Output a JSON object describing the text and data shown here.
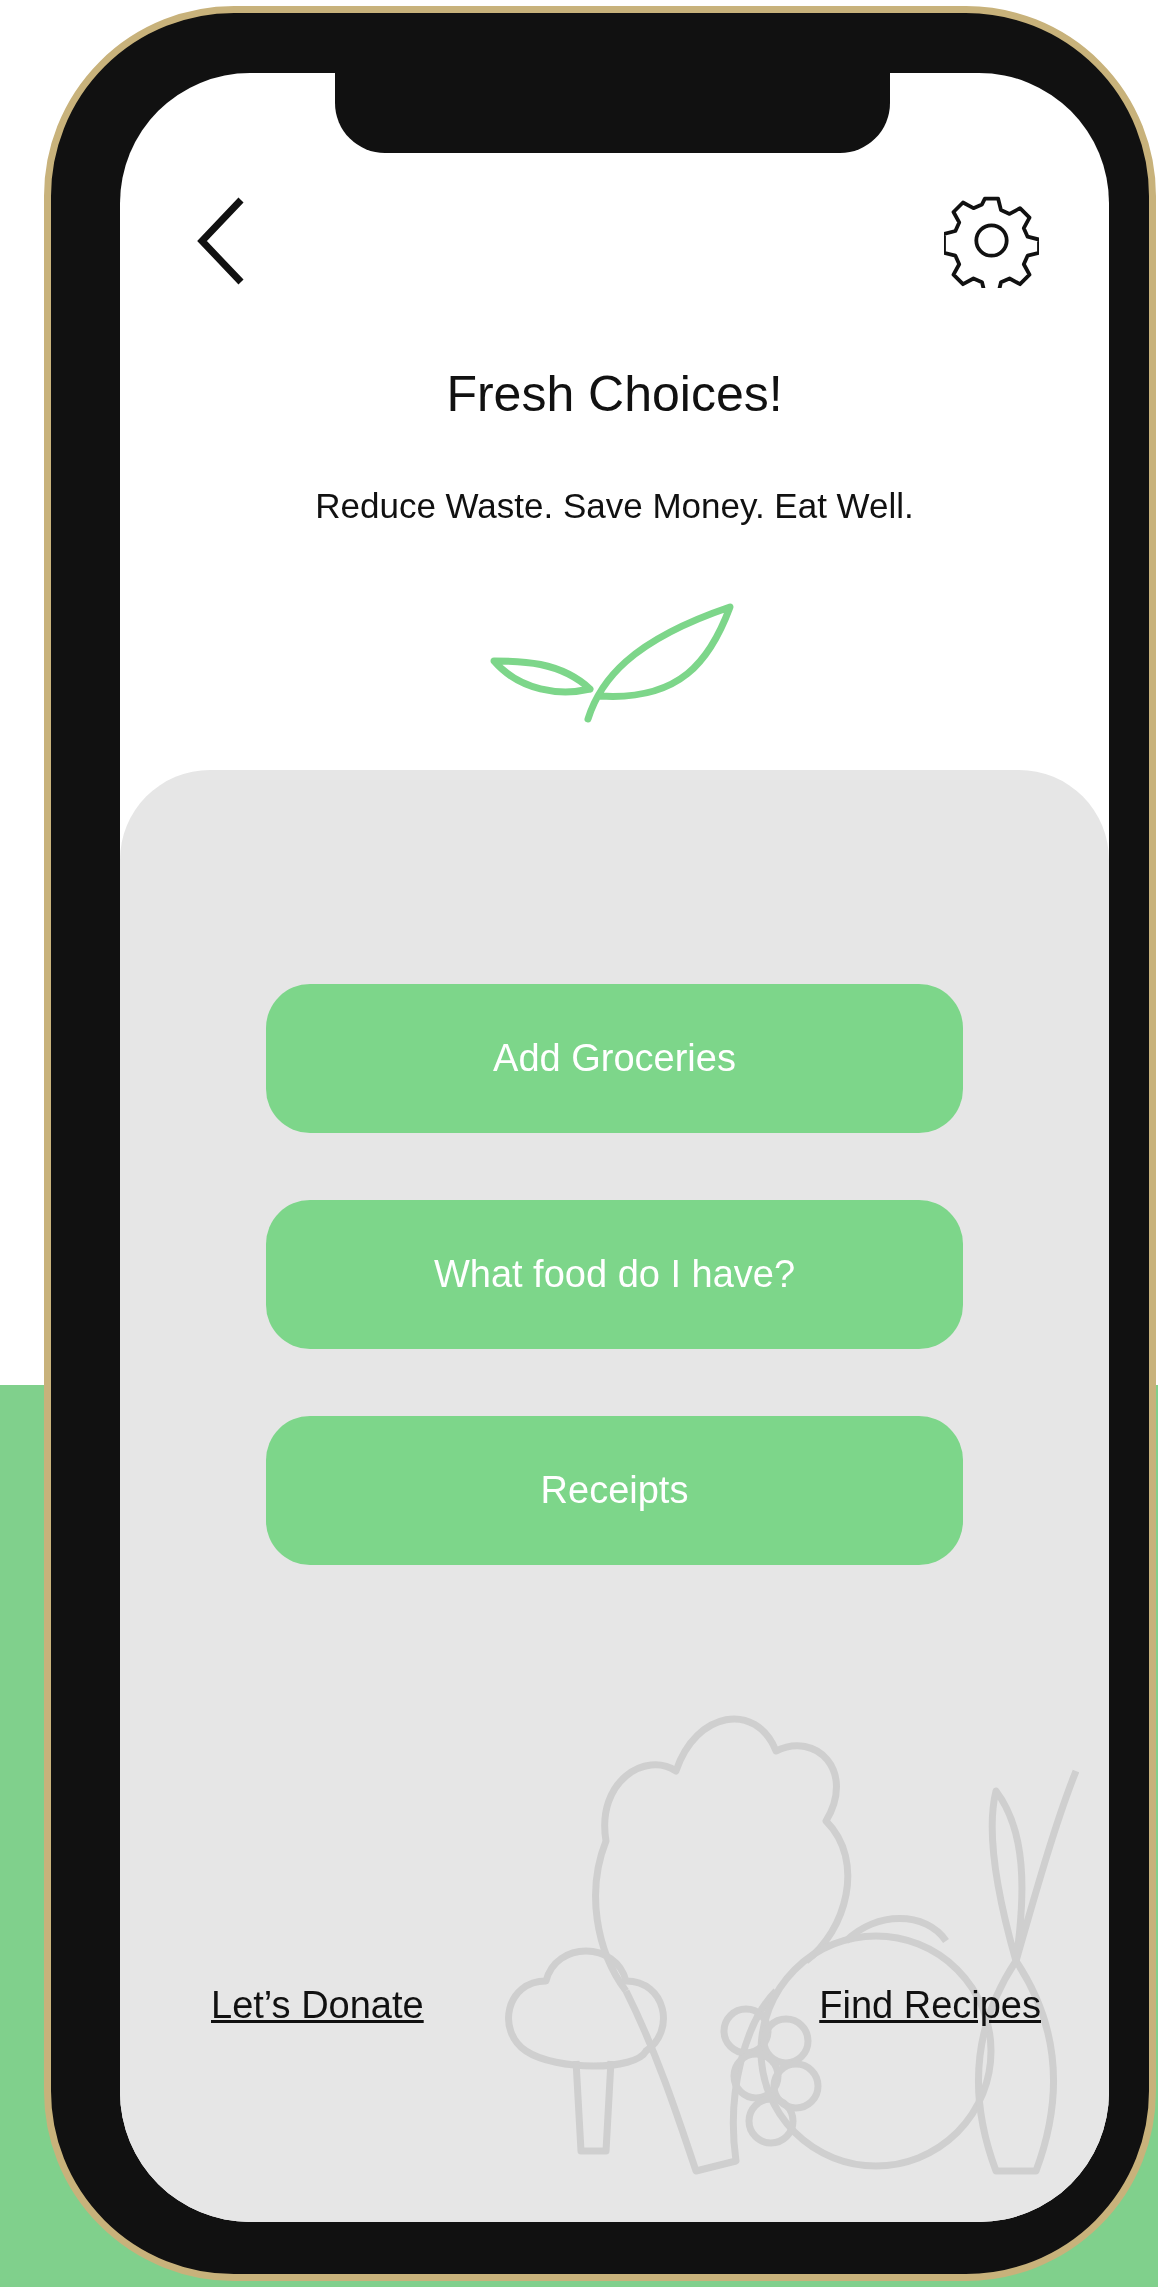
{
  "header": {
    "title": "Fresh Choices!",
    "subtitle": "Reduce Waste. Save Money. Eat Well."
  },
  "actions": [
    {
      "label": "Add Groceries"
    },
    {
      "label": "What food do I have?"
    },
    {
      "label": "Receipts"
    }
  ],
  "links": [
    {
      "label": "Let’s Donate"
    },
    {
      "label": "Find Recipes"
    }
  ]
}
